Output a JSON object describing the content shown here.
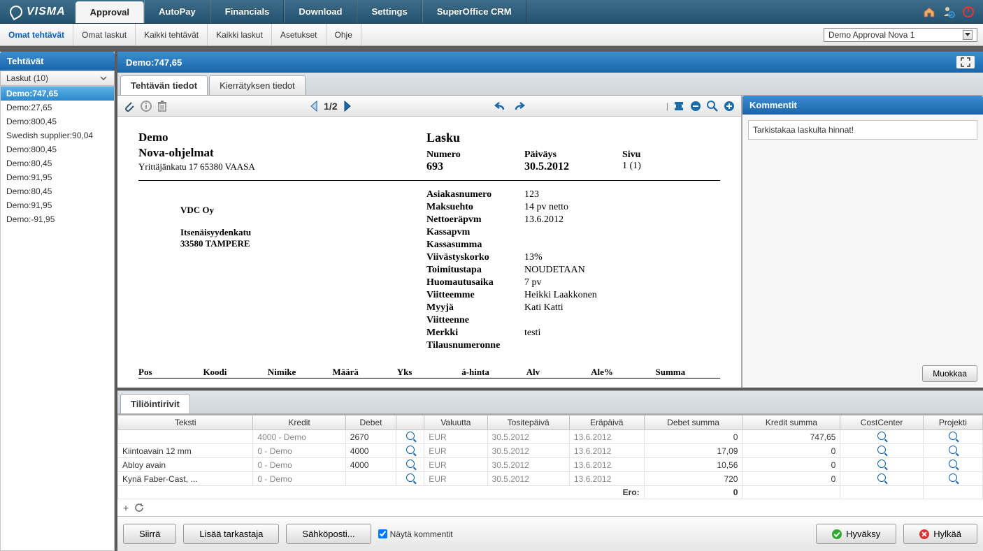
{
  "logo_text": "VISMA",
  "nav": [
    "Approval",
    "AutoPay",
    "Financials",
    "Download",
    "Settings",
    "SuperOffice CRM"
  ],
  "nav_active": 0,
  "subnav": [
    "Omat tehtävät",
    "Omat laskut",
    "Kaikki tehtävät",
    "Kaikki laskut",
    "Asetukset",
    "Ohje"
  ],
  "subnav_active": 0,
  "env": "Demo Approval Nova 1",
  "sidebar": {
    "title": "Tehtävät",
    "dropdown": "Laskut (10)",
    "items": [
      "Demo:747,65",
      "Demo:27,65",
      "Demo:800,45",
      "Swedish supplier:90,04",
      "Demo:800,45",
      "Demo:80,45",
      "Demo:91,95",
      "Demo:80,45",
      "Demo:91,95",
      "Demo:-91,95"
    ],
    "selected": 0
  },
  "doc_title": "Demo:747,65",
  "doc_tabs": [
    "Tehtävän tiedot",
    "Kierrätyksen tiedot"
  ],
  "doc_tab_active": 0,
  "pager": "1/2",
  "invoice": {
    "company1": "Demo",
    "company2": "Nova-ohjelmat",
    "addr": "Yrittäjänkatu 17 65380  VAASA",
    "title": "Lasku",
    "num_label": "Numero",
    "num": "693",
    "date_label": "Päiväys",
    "date": "30.5.2012",
    "page_label": "Sivu",
    "page": "1 (1)",
    "bill_to_name": "VDC Oy",
    "bill_to_addr1": "Itsenäisyydenkatu",
    "bill_to_addr2": "33580 TAMPERE",
    "fields": [
      {
        "k": "Asiakasnumero",
        "v": "123"
      },
      {
        "k": "Maksuehto",
        "v": "14 pv netto"
      },
      {
        "k": "Nettoeräpvm",
        "v": "13.6.2012"
      },
      {
        "k": "Kassapvm",
        "v": ""
      },
      {
        "k": "Kassasumma",
        "v": ""
      },
      {
        "k": "Viivästyskorko",
        "v": "13%"
      },
      {
        "k": "Toimitustapa",
        "v": "NOUDETAAN"
      },
      {
        "k": "Huomautusaika",
        "v": "7 pv"
      },
      {
        "k": "Viitteemme",
        "v": "Heikki Laakkonen"
      },
      {
        "k": "Myyjä",
        "v": "Kati Katti"
      },
      {
        "k": "Viitteenne",
        "v": ""
      },
      {
        "k": "Merkki",
        "v": "testi"
      },
      {
        "k": "Tilausnumeronne",
        "v": ""
      }
    ],
    "line_headers": [
      "Pos",
      "Koodi",
      "Nimike",
      "Määrä",
      "Yks",
      "á-hinta",
      "Alv",
      "Ale%",
      "Summa"
    ]
  },
  "comments": {
    "title": "Kommentit",
    "text": "Tarkistakaa laskulta hinnat!",
    "edit": "Muokkaa"
  },
  "acct": {
    "tab": "Tiliöintirivit",
    "cols": [
      "Teksti",
      "Kredit",
      "Debet",
      "",
      "Valuutta",
      "Tositepäivä",
      "Eräpäivä",
      "Debet summa",
      "Kredit summa",
      "CostCenter",
      "Projekti"
    ],
    "rows": [
      {
        "teksti": "",
        "kredit": "4000 - Demo",
        "debet": "2670",
        "val": "EUR",
        "tos": "30.5.2012",
        "era": "13.6.2012",
        "ds": "0",
        "ks": "747,65"
      },
      {
        "teksti": "Kiintoavain 12 mm",
        "kredit": "0 - Demo",
        "debet": "4000",
        "val": "EUR",
        "tos": "30.5.2012",
        "era": "13.6.2012",
        "ds": "17,09",
        "ks": "0"
      },
      {
        "teksti": "Abloy avain",
        "kredit": "0 - Demo",
        "debet": "4000",
        "val": "EUR",
        "tos": "30.5.2012",
        "era": "13.6.2012",
        "ds": "10,56",
        "ks": "0"
      },
      {
        "teksti": "Kynä Faber-Cast, ...",
        "kredit": "0 - Demo",
        "debet": "",
        "val": "EUR",
        "tos": "30.5.2012",
        "era": "13.6.2012",
        "ds": "720",
        "ks": "0"
      }
    ],
    "ero_label": "Ero:",
    "ero_val": "0"
  },
  "footer": {
    "move": "Siirrä",
    "add": "Lisää tarkastaja",
    "mail": "Sähköposti...",
    "show_cm": "Näytä kommentit",
    "approve": "Hyväksy",
    "reject": "Hylkää"
  }
}
